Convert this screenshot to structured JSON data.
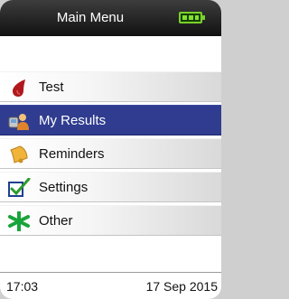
{
  "header": {
    "title": "Main Menu",
    "battery_icon": "battery-full-icon"
  },
  "menu": {
    "items": [
      {
        "label": "Test",
        "icon": "blood-drop-icon"
      },
      {
        "label": "My Results",
        "icon": "results-icon",
        "selected": true
      },
      {
        "label": "Reminders",
        "icon": "bell-icon"
      },
      {
        "label": "Settings",
        "icon": "checkbox-icon"
      },
      {
        "label": "Other",
        "icon": "star-icon"
      }
    ]
  },
  "footer": {
    "time": "17:03",
    "date": "17 Sep 2015"
  },
  "colors": {
    "selection": "#2f3c8f",
    "battery": "#7ad12a",
    "header": "#111111"
  }
}
